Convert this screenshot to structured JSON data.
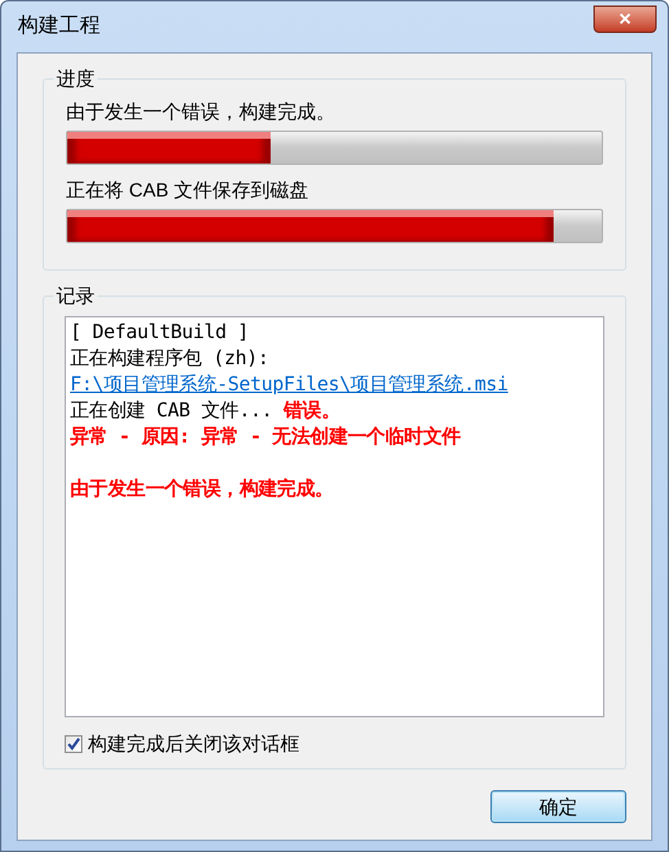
{
  "window": {
    "title": "构建工程",
    "close": "✕"
  },
  "progress": {
    "title": "进度",
    "items": [
      {
        "label": "由于发生一个错误，构建完成。",
        "level": 0.38
      },
      {
        "label": "正在将 CAB 文件保存到磁盘",
        "level": 0.91
      }
    ]
  },
  "log": {
    "title": "记录",
    "blocks": [
      {
        "lines": [
          {
            "segments": [
              {
                "kind": "plain",
                "text": "[ DefaultBuild ]"
              }
            ]
          },
          {
            "segments": [
              {
                "kind": "plain",
                "text": "正在构建程序包 (zh): "
              },
              {
                "kind": "link",
                "text": "F:\\项目管理系统-SetupFiles\\项目管理系统.msi"
              }
            ]
          },
          {
            "segments": [
              {
                "kind": "plain",
                "text": "正在创建 CAB 文件... "
              },
              {
                "kind": "error",
                "text": "错误。"
              }
            ]
          },
          {
            "segments": [
              {
                "kind": "error",
                "text": "异常 - 原因: 异常 - 无法创建一个临时文件"
              }
            ]
          }
        ]
      },
      {
        "lines": [
          {
            "segments": [
              {
                "kind": "error",
                "text": "由于发生一个错误，构建完成。"
              }
            ]
          }
        ]
      }
    ]
  },
  "close_when_done": {
    "label": "构建完成后关闭该对话框",
    "checked": true
  },
  "ok_button": "确定"
}
